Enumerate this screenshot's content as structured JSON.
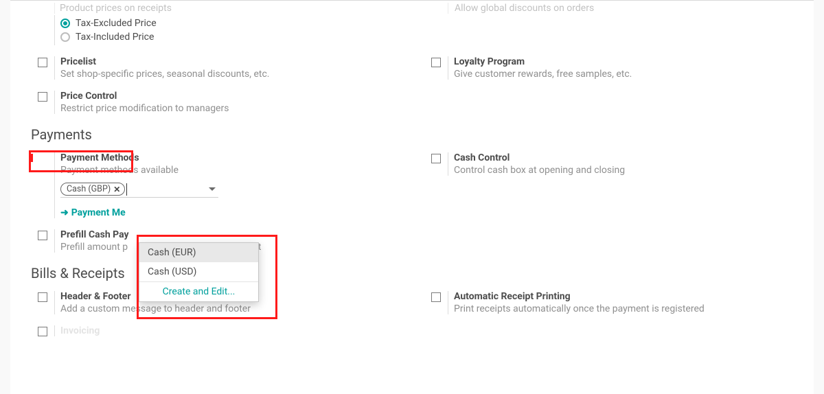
{
  "pricing": {
    "receipts_title": "Product prices on receipts",
    "radio_excluded": "Tax-Excluded Price",
    "radio_included": "Tax-Included Price",
    "pricelist_label": "Pricelist",
    "pricelist_desc": "Set shop-specific prices, seasonal discounts, etc.",
    "price_control_label": "Price Control",
    "price_control_desc": "Restrict price modification to managers",
    "global_discounts_desc": "Allow global discounts on orders",
    "loyalty_label": "Loyalty Program",
    "loyalty_desc": "Give customer rewards, free samples, etc."
  },
  "sections": {
    "payments": "Payments",
    "bills": "Bills & Receipts"
  },
  "payments": {
    "methods_label": "Payment Methods",
    "methods_desc": "Payment methods available",
    "tag_label": "Cash (GBP)",
    "link_label": "Payment Me",
    "prefill_label": "Prefill Cash Pay",
    "prefill_desc_left": "Prefill amount p",
    "prefill_desc_right": "nt",
    "cash_control_label": "Cash Control",
    "cash_control_desc": "Control cash box at opening and closing",
    "dropdown": {
      "opt1": "Cash (EUR)",
      "opt2": "Cash (USD)",
      "create": "Create and Edit..."
    }
  },
  "bills": {
    "header_footer_label": "Header & Footer",
    "header_footer_desc": "Add a custom message to header and footer",
    "auto_print_label": "Automatic Receipt Printing",
    "auto_print_desc": "Print receipts automatically once the payment is registered",
    "invoicing_label": "Invoicing"
  }
}
